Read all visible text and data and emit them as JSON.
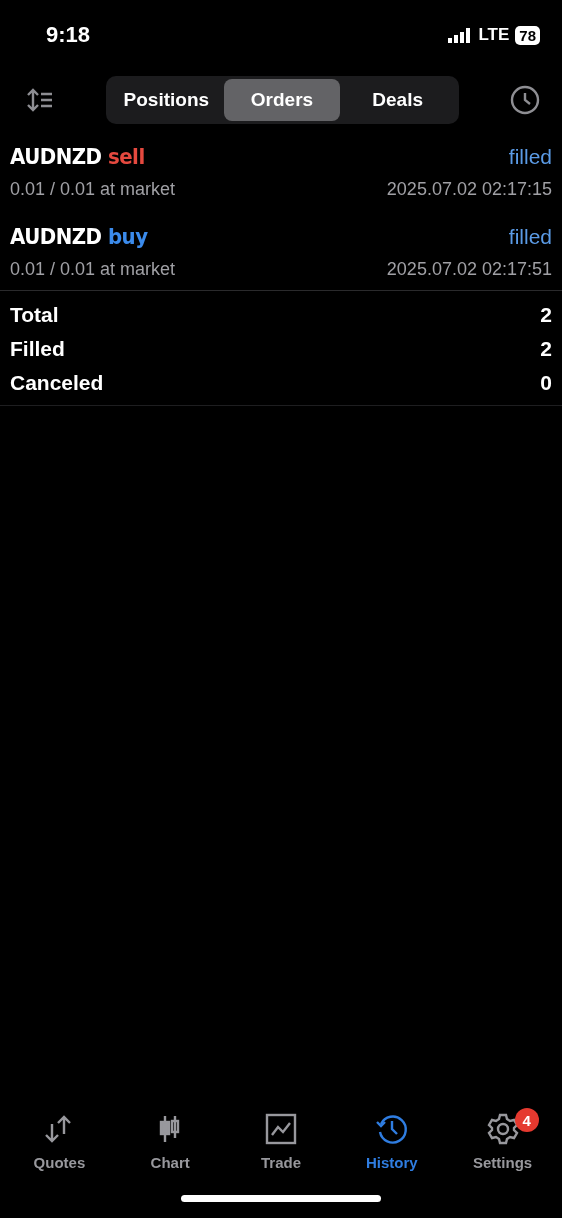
{
  "status_bar": {
    "time": "9:18",
    "network": "LTE",
    "battery": "78"
  },
  "tabs": [
    {
      "label": "Positions",
      "selected": false
    },
    {
      "label": "Orders",
      "selected": true
    },
    {
      "label": "Deals",
      "selected": false
    }
  ],
  "orders": [
    {
      "symbol": "AUDNZD",
      "side": "sell",
      "kind": "sell",
      "status": "filled",
      "volume": "0.01 / 0.01 at market",
      "time": "2025.07.02 02:17:15"
    },
    {
      "symbol": "AUDNZD",
      "side": "buy",
      "kind": "buy",
      "status": "filled",
      "volume": "0.01 / 0.01 at market",
      "time": "2025.07.02 02:17:51"
    }
  ],
  "summary": [
    {
      "label": "Total",
      "value": "2"
    },
    {
      "label": "Filled",
      "value": "2"
    },
    {
      "label": "Canceled",
      "value": "0"
    }
  ],
  "nav": [
    {
      "label": "Quotes",
      "kind": "quotes",
      "selected": false
    },
    {
      "label": "Chart",
      "kind": "chart",
      "selected": false
    },
    {
      "label": "Trade",
      "kind": "trade",
      "selected": false
    },
    {
      "label": "History",
      "kind": "history",
      "selected": true
    },
    {
      "label": "Settings",
      "kind": "settings",
      "selected": false,
      "badge": "4"
    }
  ]
}
